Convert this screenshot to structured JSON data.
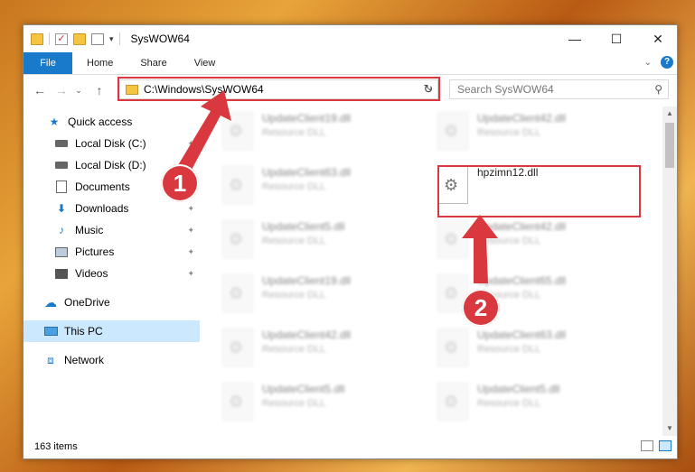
{
  "window": {
    "title": "SysWOW64",
    "controls": {
      "minimize": "—",
      "maximize": "☐",
      "close": "✕"
    }
  },
  "ribbon": {
    "tabs": [
      "File",
      "Home",
      "Share",
      "View"
    ]
  },
  "nav": {
    "address": "C:\\Windows\\SysWOW64",
    "search_placeholder": "Search SysWOW64"
  },
  "annotations": {
    "badge1": "1",
    "badge2": "2",
    "color": "#d9393e"
  },
  "sidebar": {
    "items": [
      {
        "label": "Quick access",
        "icon": "star-icon"
      },
      {
        "label": "Local Disk (C:)",
        "icon": "disk-icon"
      },
      {
        "label": "Local Disk (D:)",
        "icon": "disk-icon"
      },
      {
        "label": "Documents",
        "icon": "documents-icon"
      },
      {
        "label": "Downloads",
        "icon": "download-icon"
      },
      {
        "label": "Music",
        "icon": "music-icon"
      },
      {
        "label": "Pictures",
        "icon": "pictures-icon"
      },
      {
        "label": "Videos",
        "icon": "videos-icon"
      },
      {
        "label": "OneDrive",
        "icon": "cloud-icon"
      },
      {
        "label": "This PC",
        "icon": "computer-icon"
      },
      {
        "label": "Network",
        "icon": "network-icon"
      }
    ]
  },
  "files": [
    {
      "name": "UpdateClient19.dll",
      "type": "Resource DLL"
    },
    {
      "name": "UpdateClient42.dll",
      "type": "Resource DLL"
    },
    {
      "name": "UpdateClient63.dll",
      "type": "Resource DLL"
    },
    {
      "name": "hpzimn12.dll",
      "type": ""
    },
    {
      "name": "UpdateClient5.dll",
      "type": "Resource DLL"
    },
    {
      "name": "UpdateClient42.dll",
      "type": "Resource DLL"
    },
    {
      "name": "UpdateClient19.dll",
      "type": "Resource DLL"
    },
    {
      "name": "UpdateClient65.dll",
      "type": "Resource DLL"
    },
    {
      "name": "UpdateClient42.dll",
      "type": "Resource DLL"
    },
    {
      "name": "UpdateClient63.dll",
      "type": "Resource DLL"
    },
    {
      "name": "UpdateClient5.dll",
      "type": "Resource DLL"
    },
    {
      "name": "UpdateClient5.dll",
      "type": "Resource DLL"
    }
  ],
  "status": {
    "item_count": "163 items"
  },
  "colors": {
    "accent": "#1979ca",
    "selected_bg": "#cce8ff"
  }
}
